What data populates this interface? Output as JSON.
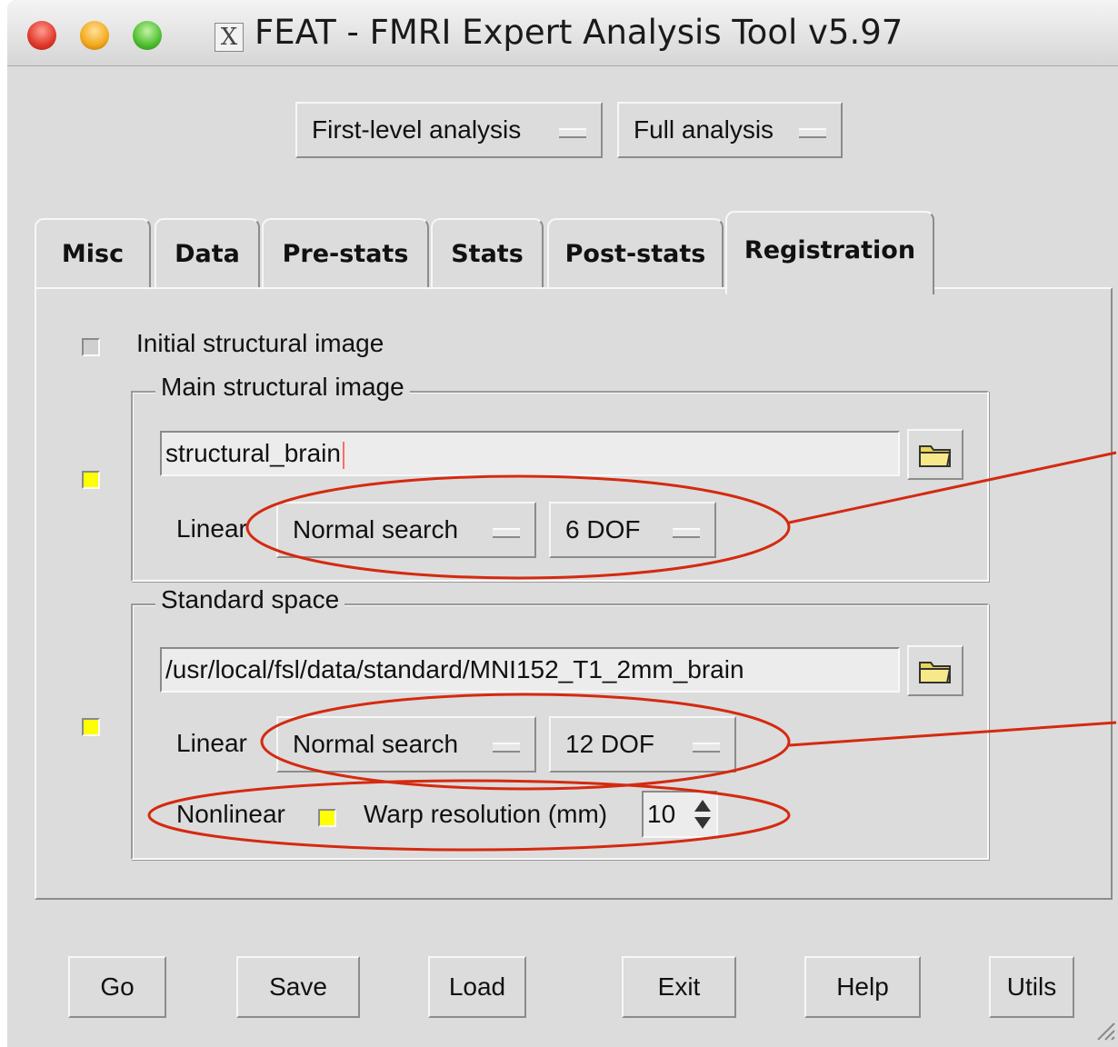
{
  "window": {
    "title": "FEAT - FMRI Expert Analysis Tool v5.97",
    "x_icon": "X"
  },
  "top_menus": {
    "analysis_level": "First-level analysis",
    "analysis_type": "Full analysis"
  },
  "tabs": [
    {
      "label": "Misc"
    },
    {
      "label": "Data"
    },
    {
      "label": "Pre-stats"
    },
    {
      "label": "Stats"
    },
    {
      "label": "Post-stats"
    },
    {
      "label": "Registration"
    }
  ],
  "active_tab": "Registration",
  "registration": {
    "initial_structural": {
      "label": "Initial structural image",
      "checked": false
    },
    "main_structural": {
      "legend": "Main structural image",
      "checked": true,
      "path": "structural_brain",
      "linear_label": "Linear",
      "search": "Normal search",
      "dof": "6 DOF"
    },
    "standard_space": {
      "legend": "Standard space",
      "checked": true,
      "path": "/usr/local/fsl/data/standard/MNI152_T1_2mm_brain",
      "linear_label": "Linear",
      "search": "Normal search",
      "dof": "12 DOF",
      "nonlinear_label": "Nonlinear",
      "nonlinear_checked": true,
      "warp_label": "Warp resolution (mm)",
      "warp_value": "10"
    }
  },
  "buttons": {
    "go": "Go",
    "save": "Save",
    "load": "Load",
    "exit": "Exit",
    "help": "Help",
    "utils": "Utils"
  },
  "colors": {
    "annotation": "#d42a10",
    "checkbox_on": "#ffff00",
    "background": "#dcdcdc"
  }
}
